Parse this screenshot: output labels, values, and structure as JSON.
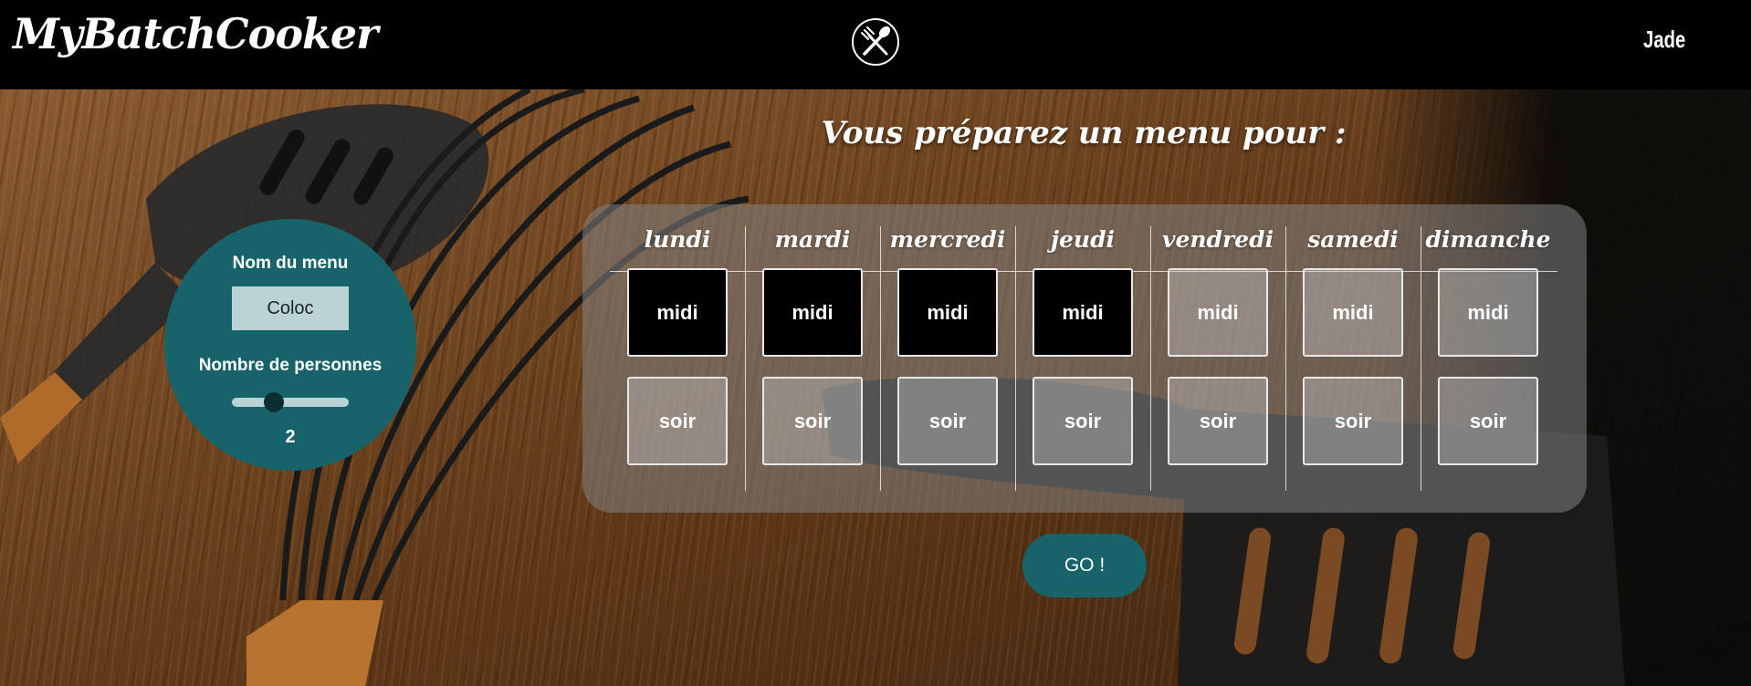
{
  "header": {
    "brand": "MyBatchCooker",
    "logo_icon": "fork-knife-icon",
    "user_name": "Jade"
  },
  "page": {
    "title": "Vous préparez un menu pour :"
  },
  "settings": {
    "menu_name_label": "Nom du menu",
    "menu_name_value": "Coloc",
    "people_label": "Nombre de personnes",
    "people_value": "2"
  },
  "planner": {
    "days": [
      {
        "name": "lundi",
        "midi": {
          "label": "midi",
          "selected": true
        },
        "soir": {
          "label": "soir",
          "selected": false
        }
      },
      {
        "name": "mardi",
        "midi": {
          "label": "midi",
          "selected": true
        },
        "soir": {
          "label": "soir",
          "selected": false
        }
      },
      {
        "name": "mercredi",
        "midi": {
          "label": "midi",
          "selected": true
        },
        "soir": {
          "label": "soir",
          "selected": false
        }
      },
      {
        "name": "jeudi",
        "midi": {
          "label": "midi",
          "selected": true
        },
        "soir": {
          "label": "soir",
          "selected": false
        }
      },
      {
        "name": "vendredi",
        "midi": {
          "label": "midi",
          "selected": false
        },
        "soir": {
          "label": "soir",
          "selected": false
        }
      },
      {
        "name": "samedi",
        "midi": {
          "label": "midi",
          "selected": false
        },
        "soir": {
          "label": "soir",
          "selected": false
        }
      },
      {
        "name": "dimanche",
        "midi": {
          "label": "midi",
          "selected": false
        },
        "soir": {
          "label": "soir",
          "selected": false
        }
      }
    ]
  },
  "actions": {
    "go_label": "GO !"
  },
  "colors": {
    "accent": "#17636a",
    "header_bg": "#000000",
    "slot_selected": "#000000",
    "input_bg": "#b9d3d7"
  }
}
